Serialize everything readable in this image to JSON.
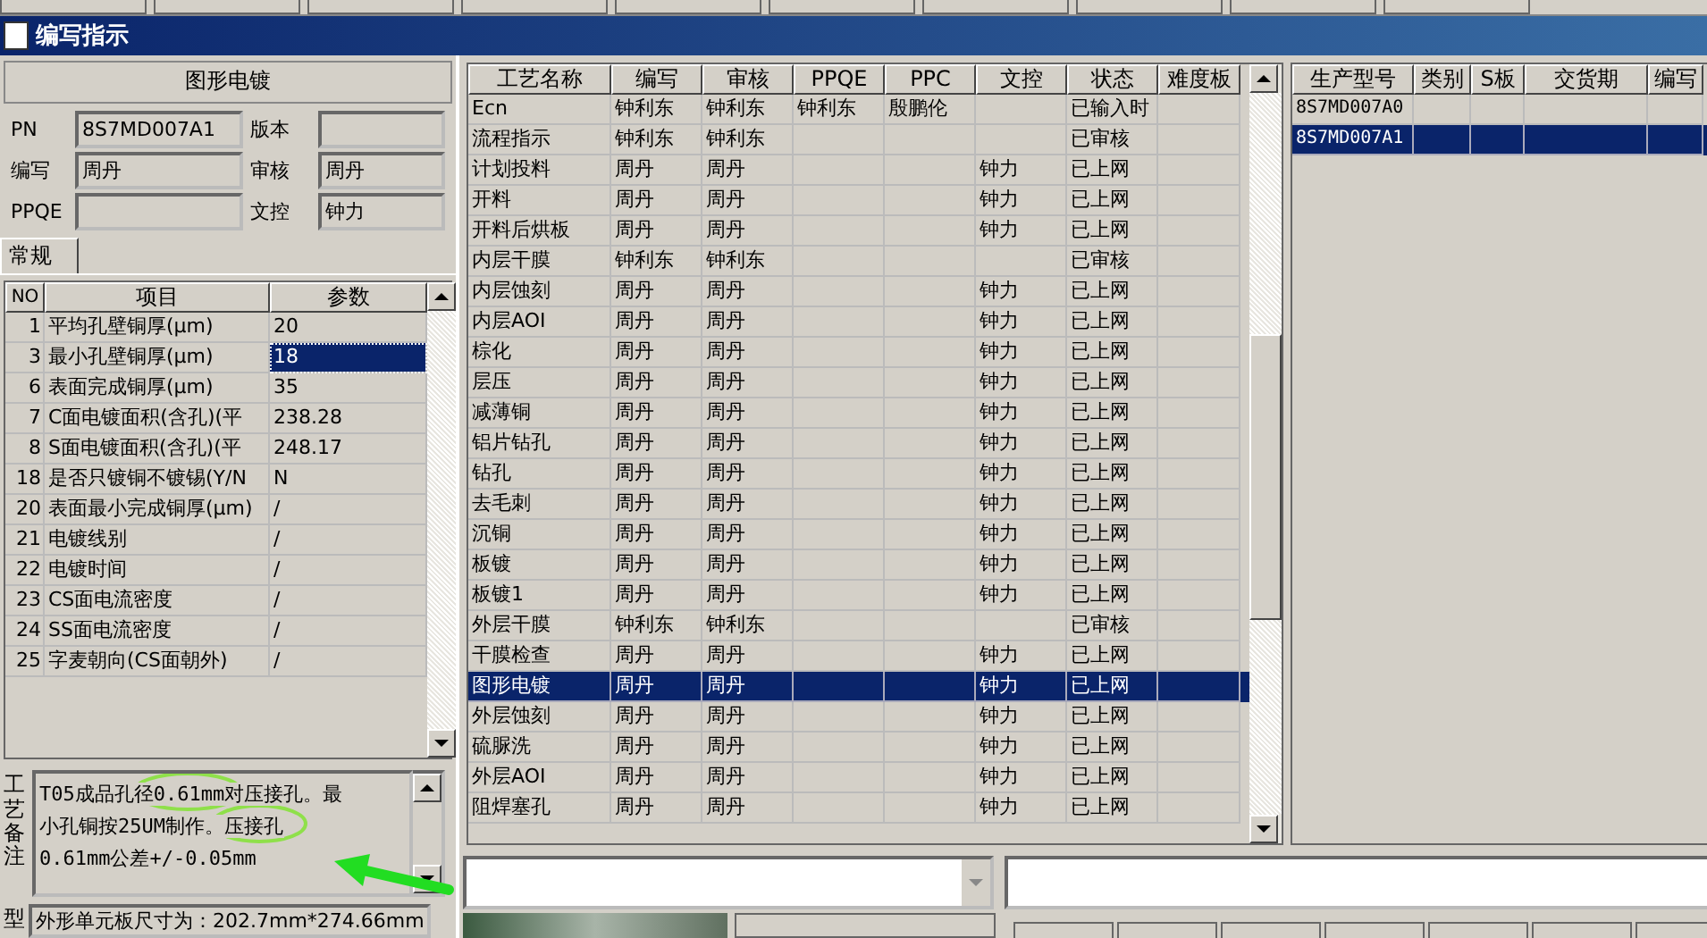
{
  "window": {
    "title": "编写指示"
  },
  "process_header": "图形电镀",
  "fields": [
    {
      "label": "PN",
      "value": "8S7MD007A1"
    },
    {
      "label": "版本"
    },
    {
      "label": "编写",
      "value": "周丹"
    },
    {
      "label": "审核",
      "value": "周丹"
    },
    {
      "label": "PPQE"
    },
    {
      "label": "文控",
      "value": "钟力"
    }
  ],
  "tabs": [
    {
      "label": "常规",
      "selected": true
    }
  ],
  "params": {
    "columns": [
      "NO",
      "项目",
      "参数"
    ],
    "rows": [
      {
        "no": "1",
        "item": "平均孔壁铜厚(μm)",
        "value": "20",
        "selected": false
      },
      {
        "no": "3",
        "item": "最小孔壁铜厚(μm)",
        "value": "18",
        "selected": true
      },
      {
        "no": "6",
        "item": "表面完成铜厚(μm)",
        "value": "35",
        "selected": false
      },
      {
        "no": "7",
        "item": "C面电镀面积(含孔)(平",
        "value": "238.28",
        "selected": false
      },
      {
        "no": "8",
        "item": "S面电镀面积(含孔)(平",
        "value": "248.17",
        "selected": false
      },
      {
        "no": "18",
        "item": "是否只镀铜不镀锡(Y/N",
        "value": "N",
        "selected": false
      },
      {
        "no": "20",
        "item": "表面最小完成铜厚(μm)",
        "value": "/",
        "selected": false
      },
      {
        "no": "21",
        "item": "电镀线别",
        "value": "/",
        "selected": false
      },
      {
        "no": "22",
        "item": "电镀时间",
        "value": "/",
        "selected": false
      },
      {
        "no": "23",
        "item": "CS面电流密度",
        "value": "/",
        "selected": false
      },
      {
        "no": "24",
        "item": "SS面电流密度",
        "value": "/",
        "selected": false
      },
      {
        "no": "25",
        "item": "字麦朝向(CS面朝外)",
        "value": "/",
        "selected": false
      }
    ]
  },
  "remarks": {
    "label": "工艺备注",
    "text": "T05成品孔径0.61mm对压接孔。最小孔铜按25UM制作。压接孔0.61mm公差+/-0.05mm"
  },
  "shape_note": {
    "label": "型",
    "text": "外形单元板尺寸为：202.7mm*274.66mm"
  },
  "process_table": {
    "columns": [
      "工艺名称",
      "编写",
      "审核",
      "PPQE",
      "PPC",
      "文控",
      "状态",
      "难度板"
    ],
    "rows": [
      {
        "cells": [
          "Ecn",
          "钟利东",
          "钟利东",
          "钟利东",
          "殷鹏伦",
          "",
          "已输入时",
          ""
        ],
        "selected": false
      },
      {
        "cells": [
          "流程指示",
          "钟利东",
          "钟利东",
          "",
          "",
          "",
          "已审核",
          ""
        ],
        "selected": false
      },
      {
        "cells": [
          "计划投料",
          "周丹",
          "周丹",
          "",
          "",
          "钟力",
          "已上网",
          ""
        ],
        "selected": false
      },
      {
        "cells": [
          "开料",
          "周丹",
          "周丹",
          "",
          "",
          "钟力",
          "已上网",
          ""
        ],
        "selected": false
      },
      {
        "cells": [
          "开料后烘板",
          "周丹",
          "周丹",
          "",
          "",
          "钟力",
          "已上网",
          ""
        ],
        "selected": false
      },
      {
        "cells": [
          "内层干膜",
          "钟利东",
          "钟利东",
          "",
          "",
          "",
          "已审核",
          ""
        ],
        "selected": false
      },
      {
        "cells": [
          "内层蚀刻",
          "周丹",
          "周丹",
          "",
          "",
          "钟力",
          "已上网",
          ""
        ],
        "selected": false
      },
      {
        "cells": [
          "内层AOI",
          "周丹",
          "周丹",
          "",
          "",
          "钟力",
          "已上网",
          ""
        ],
        "selected": false
      },
      {
        "cells": [
          "棕化",
          "周丹",
          "周丹",
          "",
          "",
          "钟力",
          "已上网",
          ""
        ],
        "selected": false
      },
      {
        "cells": [
          "层压",
          "周丹",
          "周丹",
          "",
          "",
          "钟力",
          "已上网",
          ""
        ],
        "selected": false
      },
      {
        "cells": [
          "减薄铜",
          "周丹",
          "周丹",
          "",
          "",
          "钟力",
          "已上网",
          ""
        ],
        "selected": false
      },
      {
        "cells": [
          "铝片钻孔",
          "周丹",
          "周丹",
          "",
          "",
          "钟力",
          "已上网",
          ""
        ],
        "selected": false
      },
      {
        "cells": [
          "钻孔",
          "周丹",
          "周丹",
          "",
          "",
          "钟力",
          "已上网",
          ""
        ],
        "selected": false
      },
      {
        "cells": [
          "去毛刺",
          "周丹",
          "周丹",
          "",
          "",
          "钟力",
          "已上网",
          ""
        ],
        "selected": false
      },
      {
        "cells": [
          "沉铜",
          "周丹",
          "周丹",
          "",
          "",
          "钟力",
          "已上网",
          ""
        ],
        "selected": false
      },
      {
        "cells": [
          "板镀",
          "周丹",
          "周丹",
          "",
          "",
          "钟力",
          "已上网",
          ""
        ],
        "selected": false
      },
      {
        "cells": [
          "板镀1",
          "周丹",
          "周丹",
          "",
          "",
          "钟力",
          "已上网",
          ""
        ],
        "selected": false
      },
      {
        "cells": [
          "外层干膜",
          "钟利东",
          "钟利东",
          "",
          "",
          "",
          "已审核",
          ""
        ],
        "selected": false
      },
      {
        "cells": [
          "干膜检查",
          "周丹",
          "周丹",
          "",
          "",
          "钟力",
          "已上网",
          ""
        ],
        "selected": false
      },
      {
        "cells": [
          "图形电镀",
          "周丹",
          "周丹",
          "",
          "",
          "钟力",
          "已上网",
          ""
        ],
        "selected": true
      },
      {
        "cells": [
          "外层蚀刻",
          "周丹",
          "周丹",
          "",
          "",
          "钟力",
          "已上网",
          ""
        ],
        "selected": false
      },
      {
        "cells": [
          "硫脲洗",
          "周丹",
          "周丹",
          "",
          "",
          "钟力",
          "已上网",
          ""
        ],
        "selected": false
      },
      {
        "cells": [
          "外层AOI",
          "周丹",
          "周丹",
          "",
          "",
          "钟力",
          "已上网",
          ""
        ],
        "selected": false
      },
      {
        "cells": [
          "阻焊塞孔",
          "周丹",
          "周丹",
          "",
          "",
          "钟力",
          "已上网",
          ""
        ],
        "selected": false
      }
    ]
  },
  "model_table": {
    "columns": [
      "生产型号",
      "类别",
      "S板",
      "交货期",
      "编写"
    ],
    "rows": [
      {
        "cells": [
          "8S7MD007A0",
          "",
          "",
          "",
          ""
        ],
        "selected": false
      },
      {
        "cells": [
          "8S7MD007A1",
          "",
          "",
          "",
          ""
        ],
        "selected": true
      }
    ]
  }
}
